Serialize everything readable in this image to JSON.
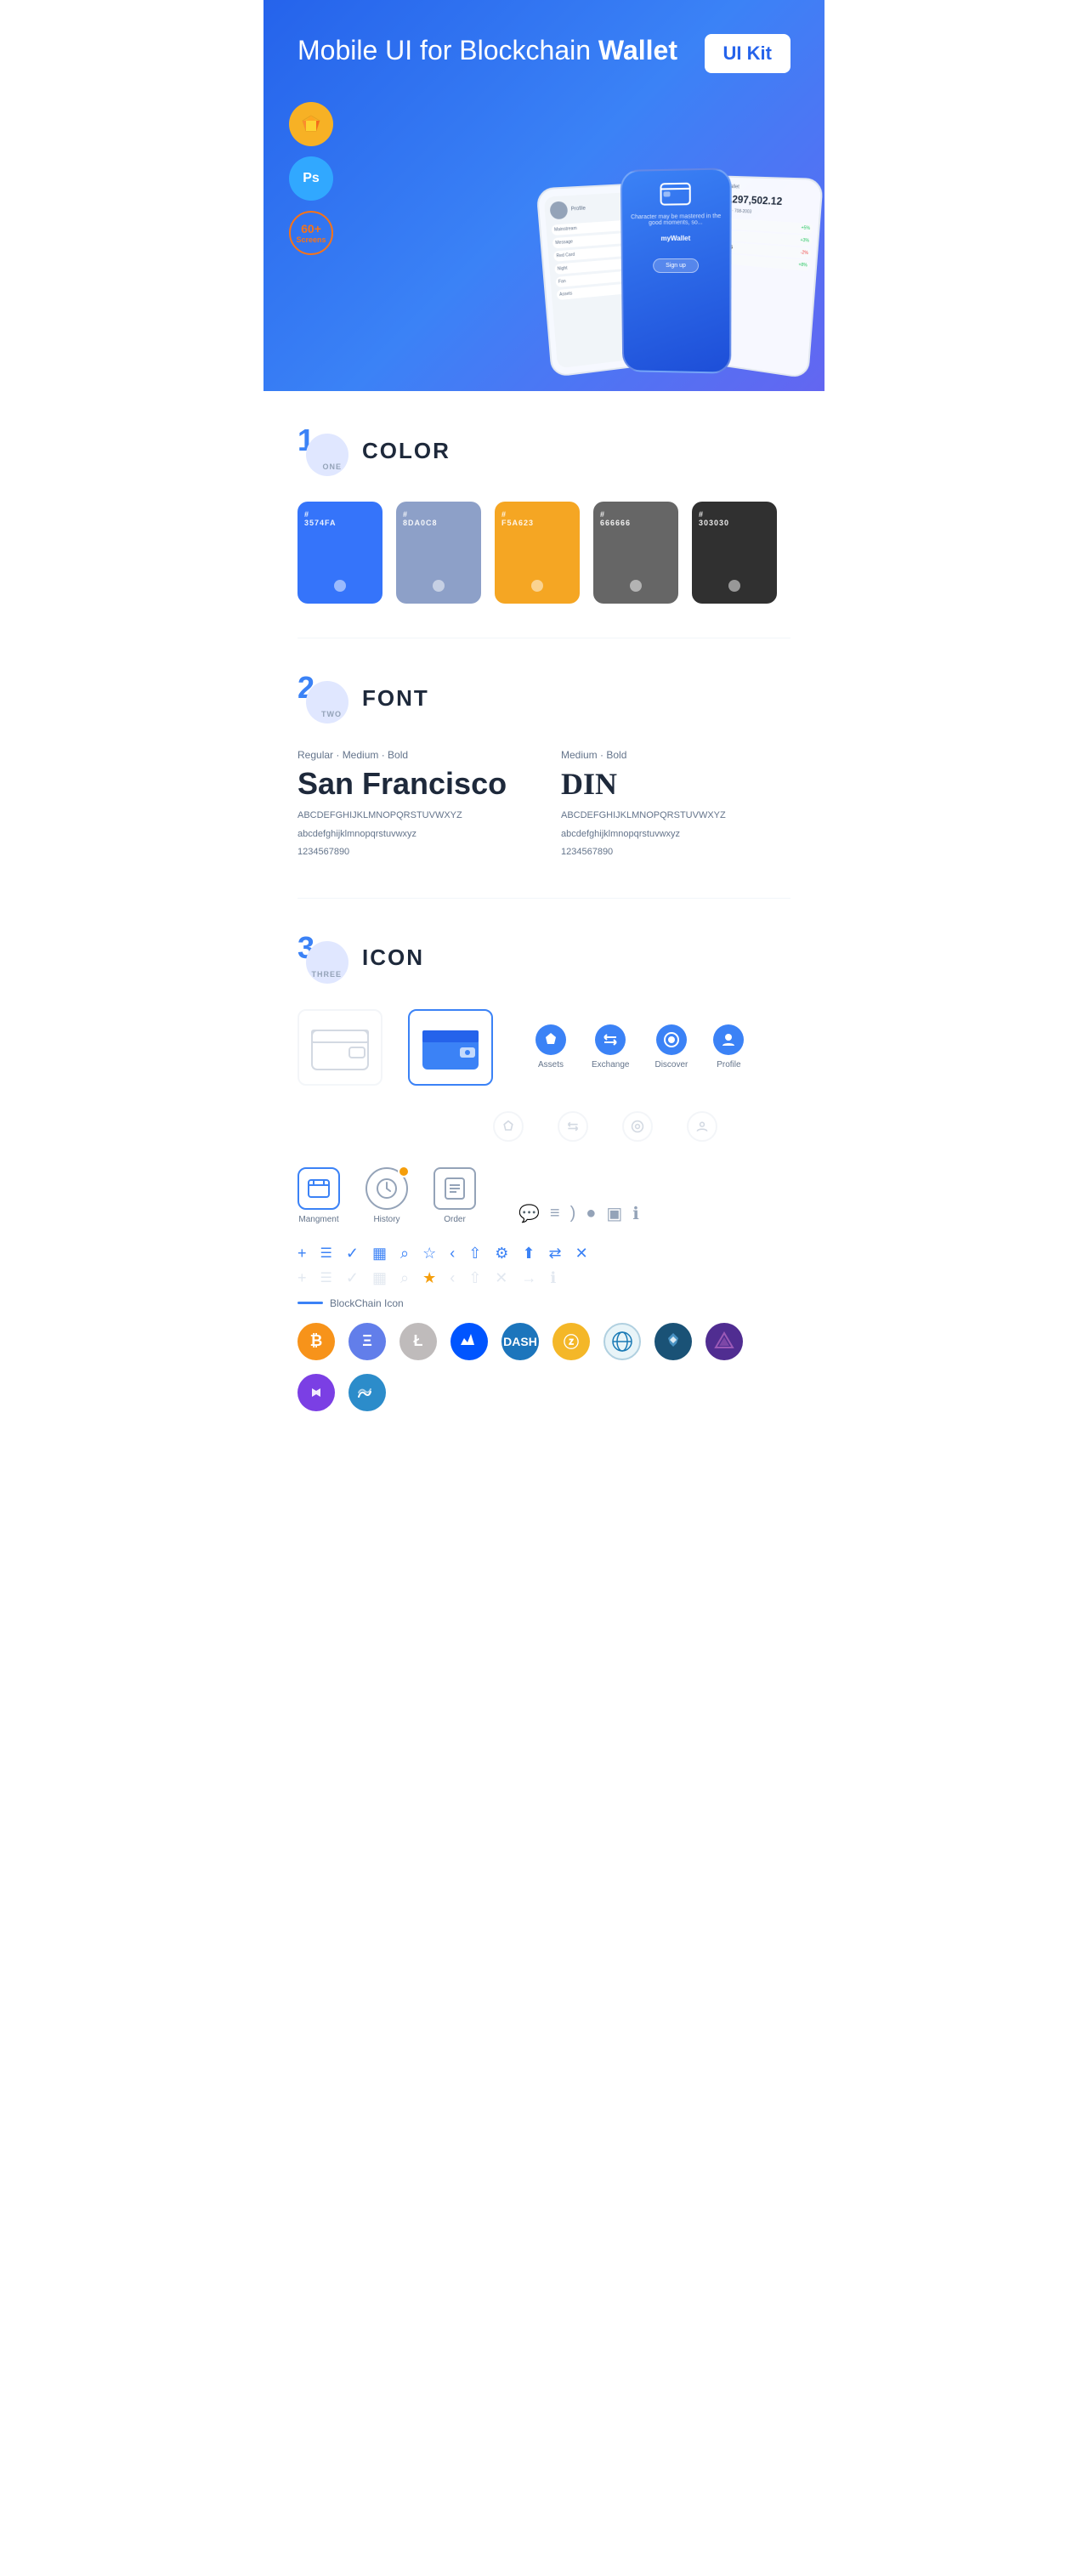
{
  "hero": {
    "title_normal": "Mobile UI for Blockchain ",
    "title_bold": "Wallet",
    "badge": "UI Kit",
    "sketch_label": "Sk",
    "ps_label": "Ps",
    "screens_label": "60+\nScreens"
  },
  "sections": {
    "color": {
      "number": "1",
      "sub": "ONE",
      "title": "COLOR",
      "swatches": [
        {
          "hex": "#3574FA",
          "label": "#\n3574FA",
          "color": "#3574FA"
        },
        {
          "hex": "#8DA0C8",
          "label": "#\n8DA0C8",
          "color": "#8DA0C8"
        },
        {
          "hex": "#F5A623",
          "label": "#\nF5A623",
          "color": "#F5A623"
        },
        {
          "hex": "#666666",
          "label": "#\n666666",
          "color": "#666666"
        },
        {
          "hex": "#303030",
          "label": "#\n303030",
          "color": "#303030"
        }
      ]
    },
    "font": {
      "number": "2",
      "sub": "TWO",
      "title": "FONT",
      "fonts": [
        {
          "weights": "Regular · Medium · Bold",
          "name": "San Francisco",
          "upper": "ABCDEFGHIJKLMNOPQRSTUVWXYZ",
          "lower": "abcdefghijklmnopqrstuvwxyz",
          "nums": "1234567890"
        },
        {
          "weights": "Medium · Bold",
          "name": "DIN",
          "upper": "ABCDEFGHIJKLMNOPQRSTUVWXYZ",
          "lower": "abcdefghijklmnopqrstuvwxyz",
          "nums": "1234567890"
        }
      ]
    },
    "icon": {
      "number": "3",
      "sub": "THREE",
      "title": "ICON",
      "nav_icons": [
        {
          "label": "Assets",
          "type": "diamond"
        },
        {
          "label": "Exchange",
          "type": "exchange"
        },
        {
          "label": "Discover",
          "type": "discover"
        },
        {
          "label": "Profile",
          "type": "profile"
        }
      ],
      "app_icons": [
        {
          "label": "Mangment",
          "type": "management"
        },
        {
          "label": "History",
          "type": "history"
        },
        {
          "label": "Order",
          "type": "order"
        }
      ],
      "blockchain_label": "BlockChain Icon"
    }
  }
}
